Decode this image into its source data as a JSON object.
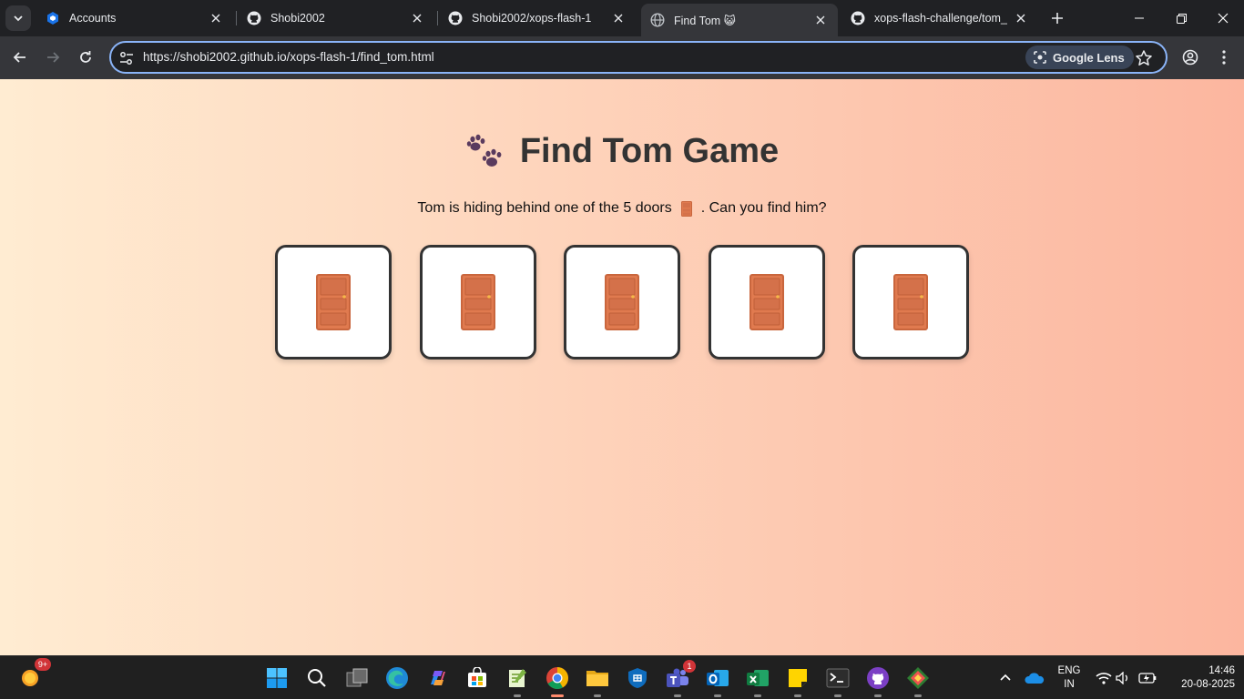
{
  "browser": {
    "tabs": [
      {
        "label": "Accounts",
        "favicon": "accounts-icon",
        "active": false
      },
      {
        "label": "Shobi2002",
        "favicon": "github-icon",
        "active": false
      },
      {
        "label": "Shobi2002/xops-flash-1",
        "favicon": "github-icon",
        "active": false
      },
      {
        "label": "Find Tom 😺",
        "favicon": "globe-icon",
        "active": true
      },
      {
        "label": "xops-flash-challenge/tom_g",
        "favicon": "github-icon",
        "active": false
      }
    ],
    "url": "https://shobi2002.github.io/xops-flash-1/find_tom.html",
    "lens_label": "Google Lens",
    "accent": "#8ab4f8"
  },
  "page": {
    "title": "Find Tom Game",
    "subtitle_before": "Tom is hiding behind one of the 5 doors",
    "subtitle_after": ". Can you find him?",
    "door_count": 5,
    "gradient_start": "#ffecd2",
    "gradient_end": "#fcb69f"
  },
  "taskbar": {
    "weather_badge": "9+",
    "teams_badge": "1",
    "lang_line1": "ENG",
    "lang_line2": "IN",
    "time": "14:46",
    "date": "20-08-2025"
  }
}
